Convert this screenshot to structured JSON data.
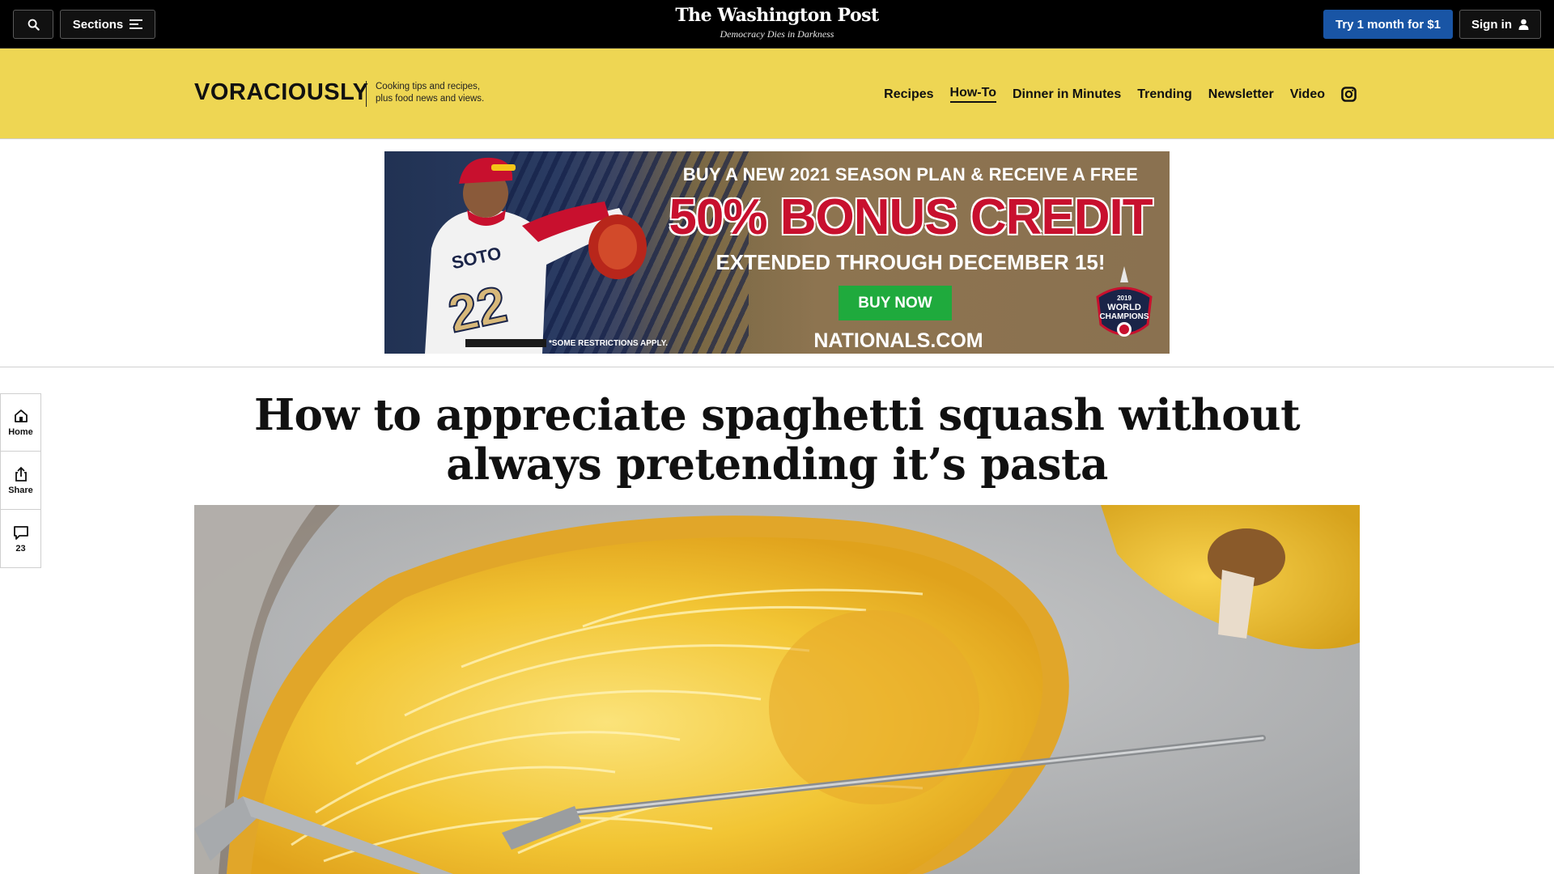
{
  "topbar": {
    "sections_label": "Sections",
    "masthead": "The Washington Post",
    "tagline": "Democracy Dies in Darkness",
    "try_label": "Try 1 month for $1",
    "signin_label": "Sign in"
  },
  "voraciously": {
    "logo_text": "VORACIOUSLY",
    "tagline_line1": "Cooking tips and recipes,",
    "tagline_line2": "plus food news and views.",
    "nav": [
      "Recipes",
      "How-To",
      "Dinner in Minutes",
      "Trending",
      "Newsletter",
      "Video"
    ],
    "active_nav": "How-To"
  },
  "ad": {
    "line1": "BUY A NEW 2021 SEASON PLAN & RECEIVE A FREE",
    "line2": "50% BONUS CREDIT",
    "line3": "EXTENDED THROUGH DECEMBER 15!",
    "button": "BUY NOW",
    "note": "*SOME RESTRICTIONS APPLY.",
    "url": "NATIONALS.COM",
    "jersey_name": "SOTO",
    "jersey_number": "22",
    "badge_year": "2019",
    "badge_line1": "WORLD",
    "badge_line2": "CHAMPIONS"
  },
  "rail": {
    "home": "Home",
    "share": "Share",
    "comments": "23"
  },
  "article": {
    "headline": "How to appreciate spaghetti squash without always pretending it’s pasta"
  },
  "colors": {
    "accent_yellow": "#eed653",
    "cta_blue": "#1955a5",
    "ad_red": "#c8102e",
    "ad_green": "#1faa3d"
  }
}
